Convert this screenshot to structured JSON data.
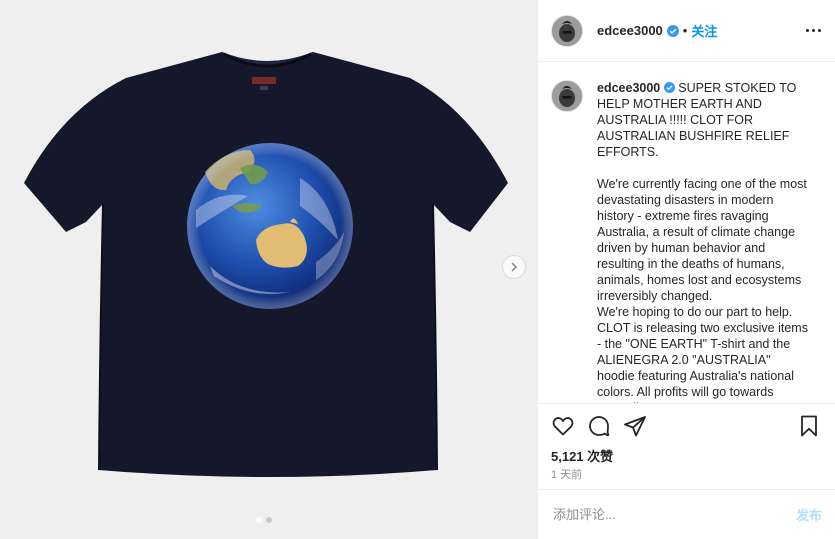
{
  "post": {
    "username": "edcee3000",
    "follow_label": "关注",
    "separator": "•",
    "caption": "SUPER STOKED TO HELP MOTHER EARTH AND AUSTRALIA !!!!! CLOT FOR AUSTRALIAN BUSHFIRE RELIEF EFFORTS.\n\nWe're currently facing one of the most devastating disasters in modern history - extreme fires ravaging Australia, a result of climate change driven by human behavior and resulting in the deaths of humans, animals, homes lost and ecosystems irreversibly changed.\nWe're hoping to do our part to help. CLOT is releasing two exclusive items - the \"ONE EARTH\" T-shirt and the ALIENEGRA 2.0 \"AUSTRALIA\" hoodie featuring Australia's national colors. All profits will go towards Australian",
    "likes": "5,121 次赞",
    "time": "1 天前",
    "comment_placeholder": "添加评论...",
    "post_button": "发布",
    "carousel": {
      "total": 2,
      "current": 1
    }
  },
  "icons": {
    "more": "more-options-icon",
    "like": "heart-icon",
    "comment": "comment-bubble-icon",
    "share": "paper-plane-icon",
    "save": "bookmark-icon",
    "next": "chevron-right-icon",
    "verified": "verified-badge-icon"
  },
  "colors": {
    "accent": "#0095f6",
    "verified": "#3897f0",
    "shirt": "#14182a",
    "background": "#efefef"
  }
}
